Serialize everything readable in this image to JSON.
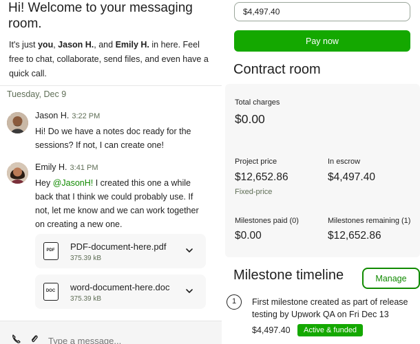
{
  "chat": {
    "welcome_title": "Hi! Welcome to your messaging room.",
    "welcome_pre": "It's just ",
    "welcome_you": "you",
    "welcome_sep1": ", ",
    "welcome_user1": "Jason H.",
    "welcome_sep2": ", and ",
    "welcome_user2": "Emily H.",
    "welcome_post": " in here. Feel free to chat, collaborate, send files, and even have a quick call.",
    "date_separator": "Tuesday, Dec 9",
    "messages": [
      {
        "name": "Jason H.",
        "time": "3:22 PM",
        "text": "Hi! Do we have a notes doc ready for the sessions? If not, I can create one!"
      },
      {
        "name": "Emily H.",
        "time": "3:41 PM",
        "mention": "@JasonH!",
        "text_pre": "Hey ",
        "text_post": " I created this one a while back that I think we could probably use. If not, let me know and we can work together on creating a new one."
      }
    ],
    "files": [
      {
        "name": "PDF-document-here.pdf",
        "size": "375.39 kB",
        "type_label": "PDF",
        "icon": "pdf-file-icon"
      },
      {
        "name": "word-document-here.doc",
        "size": "375.39 kB",
        "type_label": "DOC",
        "icon": "doc-file-icon"
      }
    ],
    "composer_placeholder": "Type a message..."
  },
  "contract": {
    "amount_value": "$4,497.40",
    "pay_label": "Pay now",
    "title": "Contract room",
    "total_charges_label": "Total charges",
    "total_charges_value": "$0.00",
    "project_price_label": "Project price",
    "project_price_value": "$12,652.86",
    "project_price_type": "Fixed-price",
    "escrow_label": "In escrow",
    "escrow_value": "$4,497.40",
    "ms_paid_label": "Milestones paid (0)",
    "ms_paid_value": "$0.00",
    "ms_remaining_label": "Milestones remaining (1)",
    "ms_remaining_value": "$12,652.86"
  },
  "timeline": {
    "title": "Milestone timeline",
    "manage_label": "Manage",
    "milestone_number": "1",
    "milestone_desc": "First milestone created as part of release testing by Upwork QA on Fri Dec 13",
    "milestone_amount": "$4,497.40",
    "milestone_status": "Active & funded"
  },
  "colors": {
    "accent_green": "#14a800",
    "link_green": "#108a00",
    "muted_text": "#5e6d55",
    "panel_bg": "#f7f7f7"
  }
}
